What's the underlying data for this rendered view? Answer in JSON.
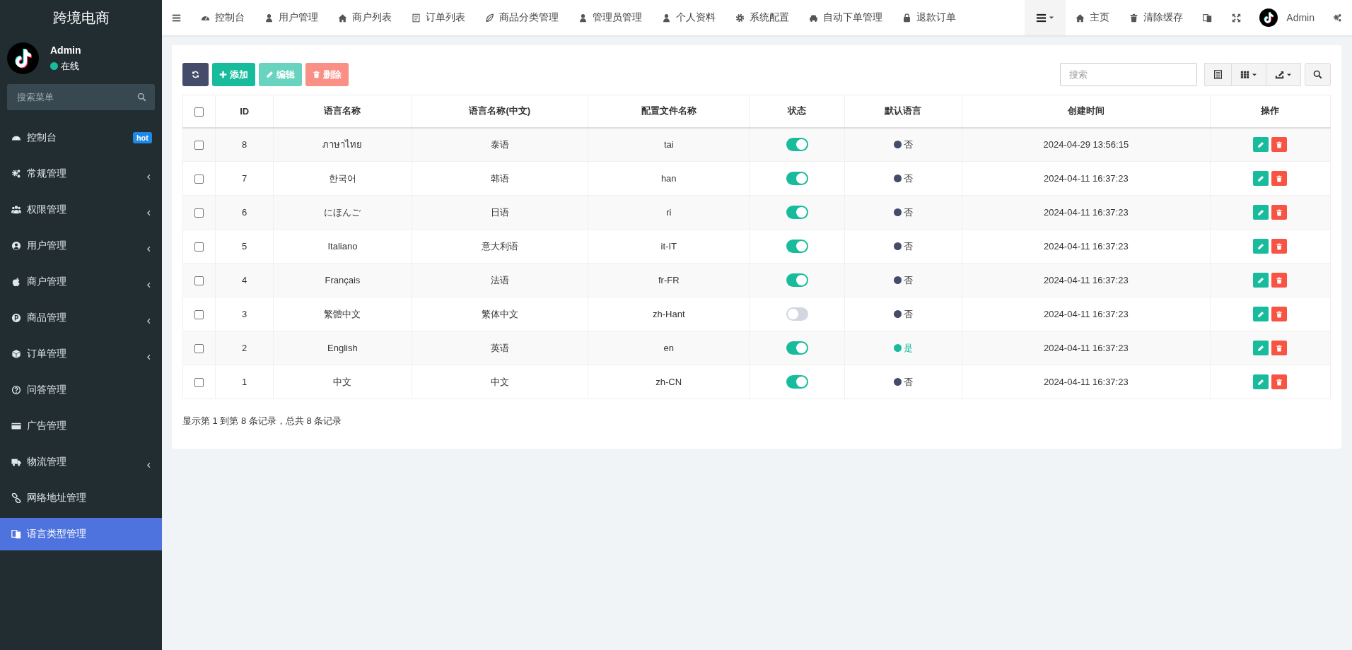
{
  "sidebar": {
    "brand": "跨境电商",
    "user": {
      "name": "Admin",
      "status": "在线",
      "online": true
    },
    "search": {
      "placeholder": "搜索菜单"
    },
    "items": [
      {
        "label": "控制台",
        "badge": "hot",
        "expandable": false,
        "selected": false
      },
      {
        "label": "常规管理",
        "expandable": true,
        "selected": false
      },
      {
        "label": "权限管理",
        "expandable": true,
        "selected": false
      },
      {
        "label": "用户管理",
        "expandable": true,
        "selected": false
      },
      {
        "label": "商户管理",
        "expandable": true,
        "selected": false
      },
      {
        "label": "商品管理",
        "expandable": true,
        "selected": false
      },
      {
        "label": "订单管理",
        "expandable": true,
        "selected": false
      },
      {
        "label": "问答管理",
        "expandable": false,
        "selected": false
      },
      {
        "label": "广告管理",
        "expandable": false,
        "selected": false
      },
      {
        "label": "物流管理",
        "expandable": true,
        "selected": false
      },
      {
        "label": "网络地址管理",
        "expandable": false,
        "selected": false
      },
      {
        "label": "语言类型管理",
        "expandable": false,
        "selected": true
      }
    ]
  },
  "topbar": {
    "tabs": [
      {
        "label": "控制台",
        "selected": false
      },
      {
        "label": "用户管理",
        "selected": false
      },
      {
        "label": "商户列表",
        "selected": false
      },
      {
        "label": "订单列表",
        "selected": false
      },
      {
        "label": "商品分类管理",
        "selected": false
      },
      {
        "label": "管理员管理",
        "selected": false
      },
      {
        "label": "个人资料",
        "selected": false
      },
      {
        "label": "系统配置",
        "selected": false
      },
      {
        "label": "自动下单管理",
        "selected": false
      },
      {
        "label": "退款订单",
        "selected": false
      }
    ],
    "links": [
      "主页",
      "清除缓存"
    ],
    "user": "Admin"
  },
  "toolbar": {
    "buttons": [
      {
        "kind": "refresh",
        "disabled": false
      },
      {
        "kind": "add",
        "label": "添加",
        "disabled": false
      },
      {
        "kind": "edit",
        "label": "编辑",
        "disabled": true
      },
      {
        "kind": "delete",
        "label": "删除",
        "disabled": true
      }
    ],
    "search": {
      "placeholder": "搜索"
    }
  },
  "table": {
    "all_checked": false,
    "columns": [
      "ID",
      "语言名称",
      "语言名称(中文)",
      "配置文件名称",
      "状态",
      "默认语言",
      "创建时间",
      "操作"
    ],
    "rows": [
      {
        "checked": false,
        "id": "8",
        "name": "ภาษาไทย",
        "name_zh": "泰语",
        "file": "tai",
        "enabled": true,
        "default": false,
        "default_label": "否",
        "created": "2024-04-29 13:56:15"
      },
      {
        "checked": false,
        "id": "7",
        "name": "한국어",
        "name_zh": "韩语",
        "file": "han",
        "enabled": true,
        "default": false,
        "default_label": "否",
        "created": "2024-04-11 16:37:23"
      },
      {
        "checked": false,
        "id": "6",
        "name": "にほんご",
        "name_zh": "日语",
        "file": "ri",
        "enabled": true,
        "default": false,
        "default_label": "否",
        "created": "2024-04-11 16:37:23"
      },
      {
        "checked": false,
        "id": "5",
        "name": "Italiano",
        "name_zh": "意大利语",
        "file": "it-IT",
        "enabled": true,
        "default": false,
        "default_label": "否",
        "created": "2024-04-11 16:37:23"
      },
      {
        "checked": false,
        "id": "4",
        "name": "Français",
        "name_zh": "法语",
        "file": "fr-FR",
        "enabled": true,
        "default": false,
        "default_label": "否",
        "created": "2024-04-11 16:37:23"
      },
      {
        "checked": false,
        "id": "3",
        "name": "繁體中文",
        "name_zh": "繁体中文",
        "file": "zh-Hant",
        "enabled": false,
        "default": false,
        "default_label": "否",
        "created": "2024-04-11 16:37:23"
      },
      {
        "checked": false,
        "id": "2",
        "name": "English",
        "name_zh": "英语",
        "file": "en",
        "enabled": true,
        "default": true,
        "default_label": "是",
        "created": "2024-04-11 16:37:23"
      },
      {
        "checked": false,
        "id": "1",
        "name": "中文",
        "name_zh": "中文",
        "file": "zh-CN",
        "enabled": true,
        "default": false,
        "default_label": "否",
        "created": "2024-04-11 16:37:23"
      }
    ]
  },
  "pagination": {
    "summary": "显示第 1 到第 8 条记录，总共 8 条记录"
  }
}
